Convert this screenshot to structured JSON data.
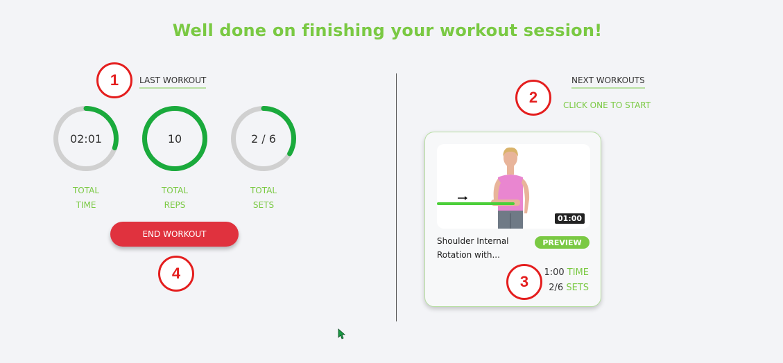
{
  "page": {
    "title": "Well done on finishing your workout session!"
  },
  "last_workout": {
    "heading": "LAST WORKOUT",
    "stats": [
      {
        "value": "02:01",
        "label_line1": "TOTAL",
        "label_line2": "TIME",
        "progress": 0.3
      },
      {
        "value": "10",
        "label_line1": "TOTAL",
        "label_line2": "REPS",
        "progress": 1.0
      },
      {
        "value": "2 / 6",
        "label_line1": "TOTAL",
        "label_line2": "SETS",
        "progress": 0.3333
      }
    ],
    "end_button_label": "END WORKOUT"
  },
  "next_workouts": {
    "heading": "NEXT WORKOUTS",
    "hint": "CLICK ONE TO START",
    "card": {
      "duration_badge": "01:00",
      "name_line1": "Shoulder Internal",
      "name_line2": "Rotation with...",
      "preview_label": "PREVIEW",
      "time_value": "1:00",
      "time_unit": "TIME",
      "sets_value": "2/6",
      "sets_unit": "SETS"
    }
  },
  "annotations": [
    "1",
    "2",
    "3",
    "4"
  ],
  "colors": {
    "accent_green": "#7ac943",
    "ring_green": "#1aaa3c",
    "ring_track": "#d0d0d0",
    "danger_red": "#e0323e",
    "annotation_red": "#e41e1e",
    "background": "#f3f4f7"
  },
  "icons": [
    "arrow-right-icon",
    "mouse-cursor-icon"
  ]
}
